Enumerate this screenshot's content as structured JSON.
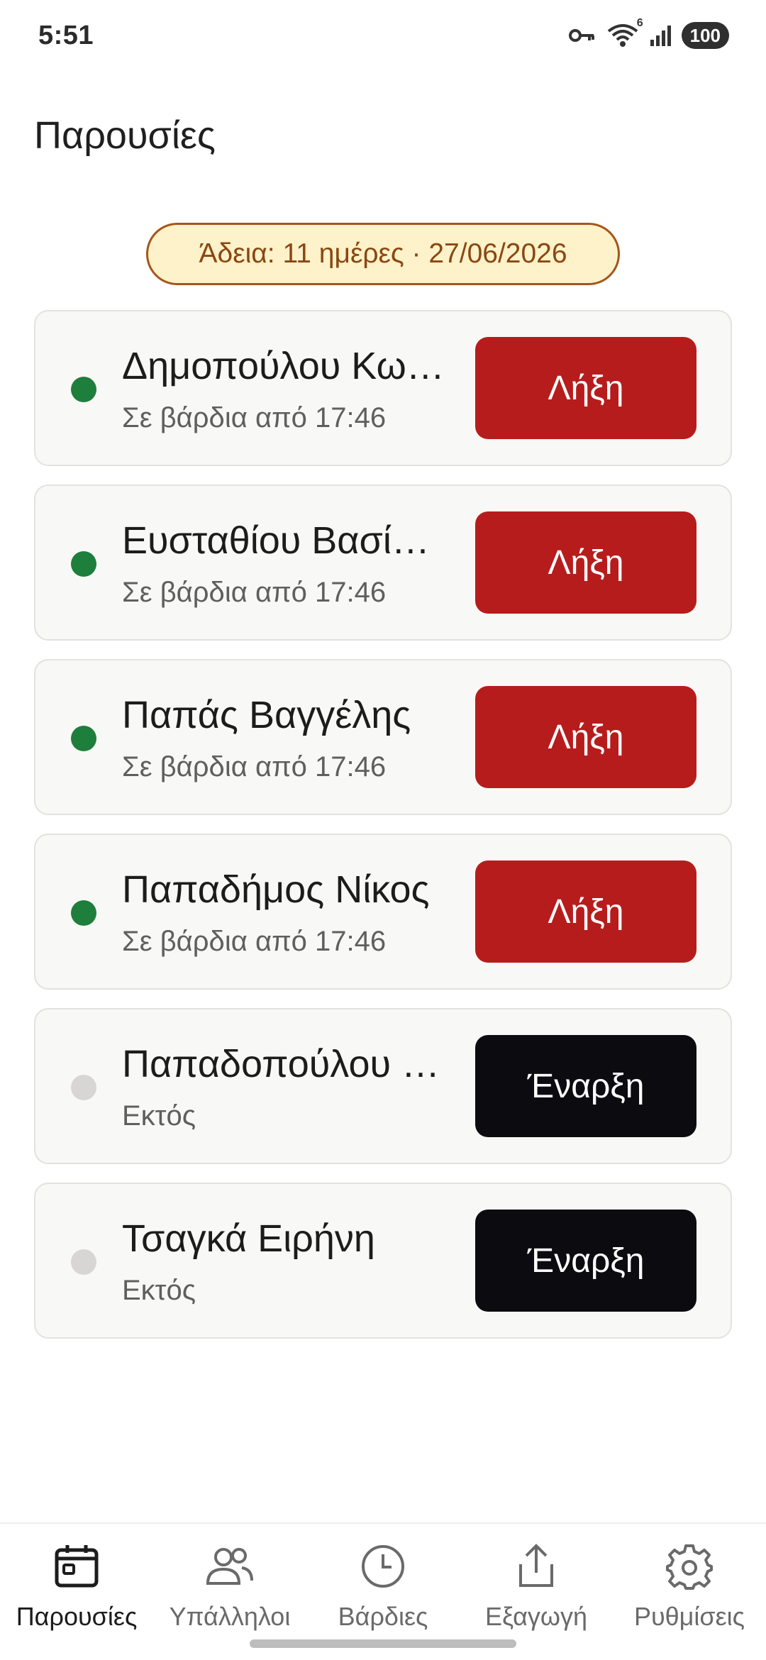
{
  "status_bar": {
    "time": "5:51",
    "battery": "100",
    "wifi_badge": "6",
    "icons": [
      "vpn-key-icon",
      "wifi-icon",
      "signal-icon",
      "battery-icon"
    ]
  },
  "header": {
    "title": "Παρουσίες"
  },
  "license": {
    "text": "Άδεια: 11 ημέρες · 27/06/2026"
  },
  "colors": {
    "active_dot": "#1e7e3c",
    "inactive_dot": "#d7d6d4",
    "stop_button": "#b71c1c",
    "start_button": "#0c0c10",
    "license_border": "#a4561a",
    "license_bg": "#fdf2c9"
  },
  "employees": [
    {
      "name": "Δημοπούλου Κω…",
      "status": "Σε βάρδια από 17:46",
      "on_shift": true,
      "action": "Λήξη"
    },
    {
      "name": "Ευσταθίου Βασίλ…",
      "status": "Σε βάρδια από 17:46",
      "on_shift": true,
      "action": "Λήξη"
    },
    {
      "name": "Παπάς Βαγγέλης",
      "status": "Σε βάρδια από 17:46",
      "on_shift": true,
      "action": "Λήξη"
    },
    {
      "name": "Παπαδήμος Νίκος",
      "status": "Σε βάρδια από 17:46",
      "on_shift": true,
      "action": "Λήξη"
    },
    {
      "name": "Παπαδοπούλου …",
      "status": "Εκτός",
      "on_shift": false,
      "action": "Έναρξη"
    },
    {
      "name": "Τσαγκά Ειρήνη",
      "status": "Εκτός",
      "on_shift": false,
      "action": "Έναρξη"
    }
  ],
  "nav": {
    "items": [
      {
        "label": "Παρουσίες",
        "icon": "calendar-icon",
        "active": true
      },
      {
        "label": "Υπάλληλοι",
        "icon": "people-icon",
        "active": false
      },
      {
        "label": "Βάρδιες",
        "icon": "clock-icon",
        "active": false
      },
      {
        "label": "Εξαγωγή",
        "icon": "share-icon",
        "active": false
      },
      {
        "label": "Ρυθμίσεις",
        "icon": "gear-icon",
        "active": false
      }
    ]
  }
}
